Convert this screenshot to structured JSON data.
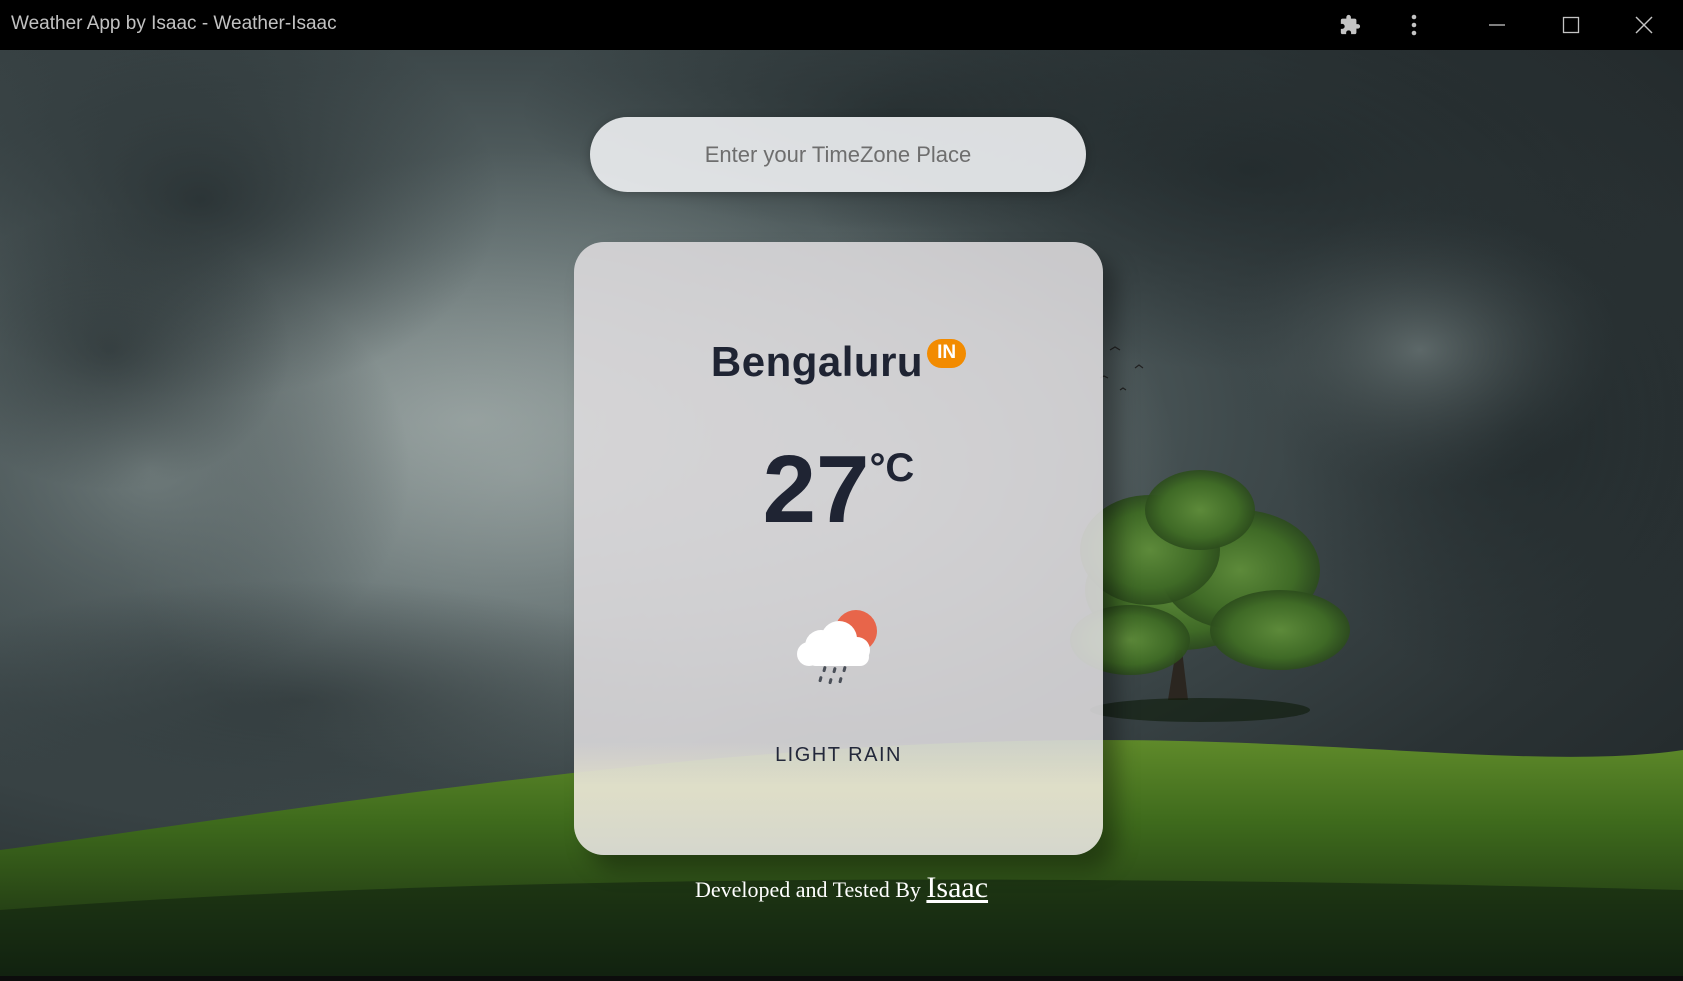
{
  "window": {
    "title": "Weather App by Isaac - Weather-Isaac"
  },
  "titlebar_icons": [
    "puzzle-icon",
    "more-vertical-icon",
    "minimize-icon",
    "maximize-icon",
    "close-icon"
  ],
  "search": {
    "placeholder": "Enter your TimeZone Place",
    "value": ""
  },
  "weather": {
    "city": "Bengaluru",
    "country": "IN",
    "temperature": "27",
    "unit": "°C",
    "condition": "LIGHT RAIN",
    "icon": "light-rain-icon"
  },
  "footer": {
    "prefix": "Developed and Tested By",
    "author": "Isaac"
  },
  "colors": {
    "badge": "#f28b00",
    "text_dark": "#1f2433",
    "sun": "#e8654a"
  }
}
